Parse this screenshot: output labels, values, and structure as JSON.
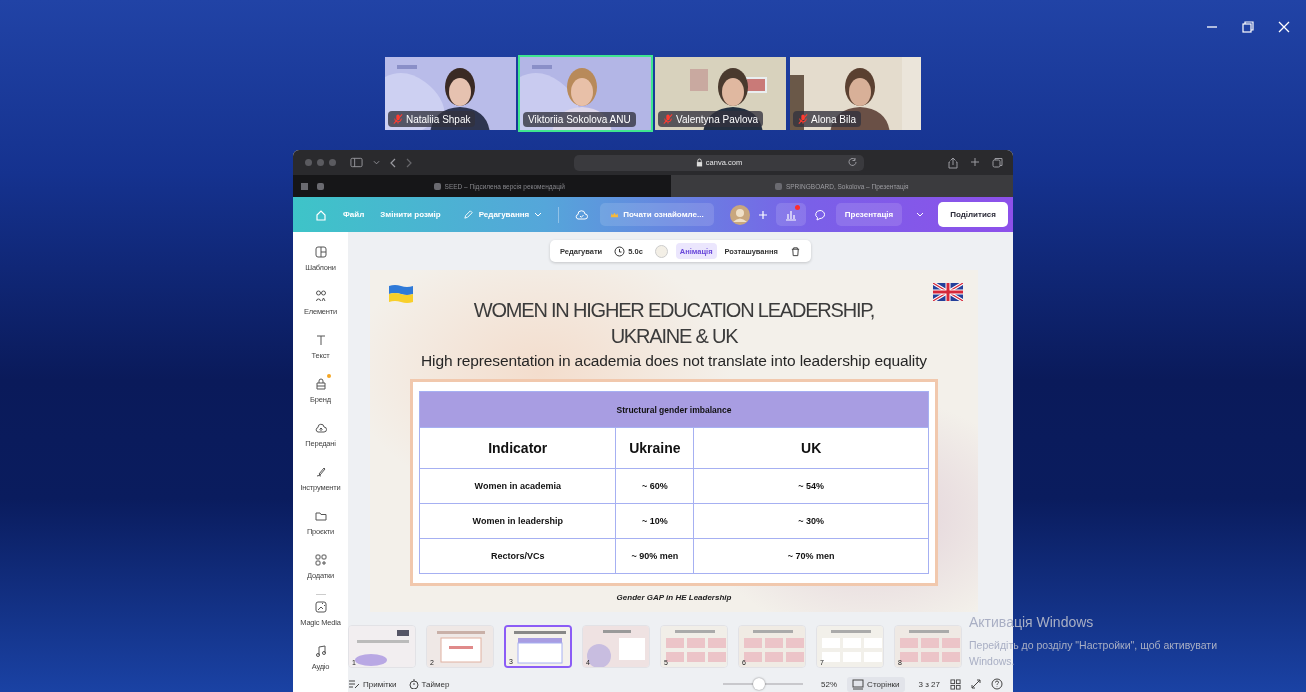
{
  "participants": [
    {
      "name": "Nataliia Shpak",
      "muted": true,
      "highlighted": false
    },
    {
      "name": "Viktoriia Sokolova ANU",
      "muted": false,
      "highlighted": true
    },
    {
      "name": "Valentyna Pavlova",
      "muted": true,
      "highlighted": false
    },
    {
      "name": "Alona Bila",
      "muted": true,
      "highlighted": false
    }
  ],
  "browser": {
    "address": "canva.com",
    "tabs": [
      {
        "title": "SEED – Підсилена версія рекомендацій",
        "selected": false
      },
      {
        "title": "SPRINGBOARD, Sokolova – Презентація",
        "selected": true
      }
    ]
  },
  "canva_bar": {
    "menu": [
      "Файл",
      "Змінити розмір"
    ],
    "edit_menu": "Редагування",
    "trial_button": "Почати ознайомле...",
    "analytics_alert": true,
    "present_button": "Презентація",
    "share_button": "Поділитися"
  },
  "sidebar": {
    "items": [
      {
        "label": "Шаблони",
        "badge": false
      },
      {
        "label": "Елементи",
        "badge": false
      },
      {
        "label": "Текст",
        "badge": false
      },
      {
        "label": "Бренд",
        "badge": true
      },
      {
        "label": "Передані",
        "badge": false
      },
      {
        "label": "Інструменти",
        "badge": false
      },
      {
        "label": "Проєкти",
        "badge": false
      },
      {
        "label": "Додатки",
        "badge": false
      },
      {
        "label": "Magic Media",
        "badge": false
      },
      {
        "label": "Аудіо",
        "badge": false
      }
    ]
  },
  "element_toolbar": {
    "buttons": [
      {
        "kind": "text",
        "label": "Редагувати",
        "selected": false
      },
      {
        "kind": "duration",
        "label": "5.0с",
        "selected": false
      },
      {
        "kind": "swatch",
        "selected": false
      },
      {
        "kind": "text",
        "label": "Анімація",
        "selected": true
      },
      {
        "kind": "text",
        "label": "Розташування",
        "selected": false
      },
      {
        "kind": "delete",
        "selected": false
      }
    ]
  },
  "slide": {
    "title": "WOMEN IN HIGHER EDUCATION LEADERSHIP, UKRAINE & UK",
    "subtitle": "High representation in academia does not translate into leadership equality",
    "table": {
      "caption": "Structural gender imbalance",
      "columns": [
        "Indicator",
        "Ukraine",
        "UK"
      ],
      "rows": [
        [
          "Women in academia",
          "~ 60%",
          "~ 54%"
        ],
        [
          "Women in leadership",
          "~ 10%",
          "~ 30%"
        ],
        [
          "Rectors/VCs",
          "~ 90% men",
          "~ 70% men"
        ]
      ]
    },
    "footnote": "Gender GAP in HE Leadership"
  },
  "thumbnails": [
    {
      "number": "1",
      "selected": false
    },
    {
      "number": "2",
      "selected": false
    },
    {
      "number": "3",
      "selected": true
    },
    {
      "number": "4",
      "selected": false
    },
    {
      "number": "5",
      "selected": false
    },
    {
      "number": "6",
      "selected": false
    },
    {
      "number": "7",
      "selected": false
    },
    {
      "number": "8",
      "selected": false
    }
  ],
  "bottom_bar": {
    "notes": "Примітки",
    "timer": "Таймер",
    "zoom": {
      "level": 0.45
    },
    "zoom_reading": "52%",
    "pages_button": {
      "label": "Сторінки",
      "selected": true
    },
    "page_count": "3 з 27"
  },
  "activation": {
    "title": "Активація Windows",
    "message": "Перейдіть до розділу \"Настройки\", щоб активувати Windows."
  }
}
